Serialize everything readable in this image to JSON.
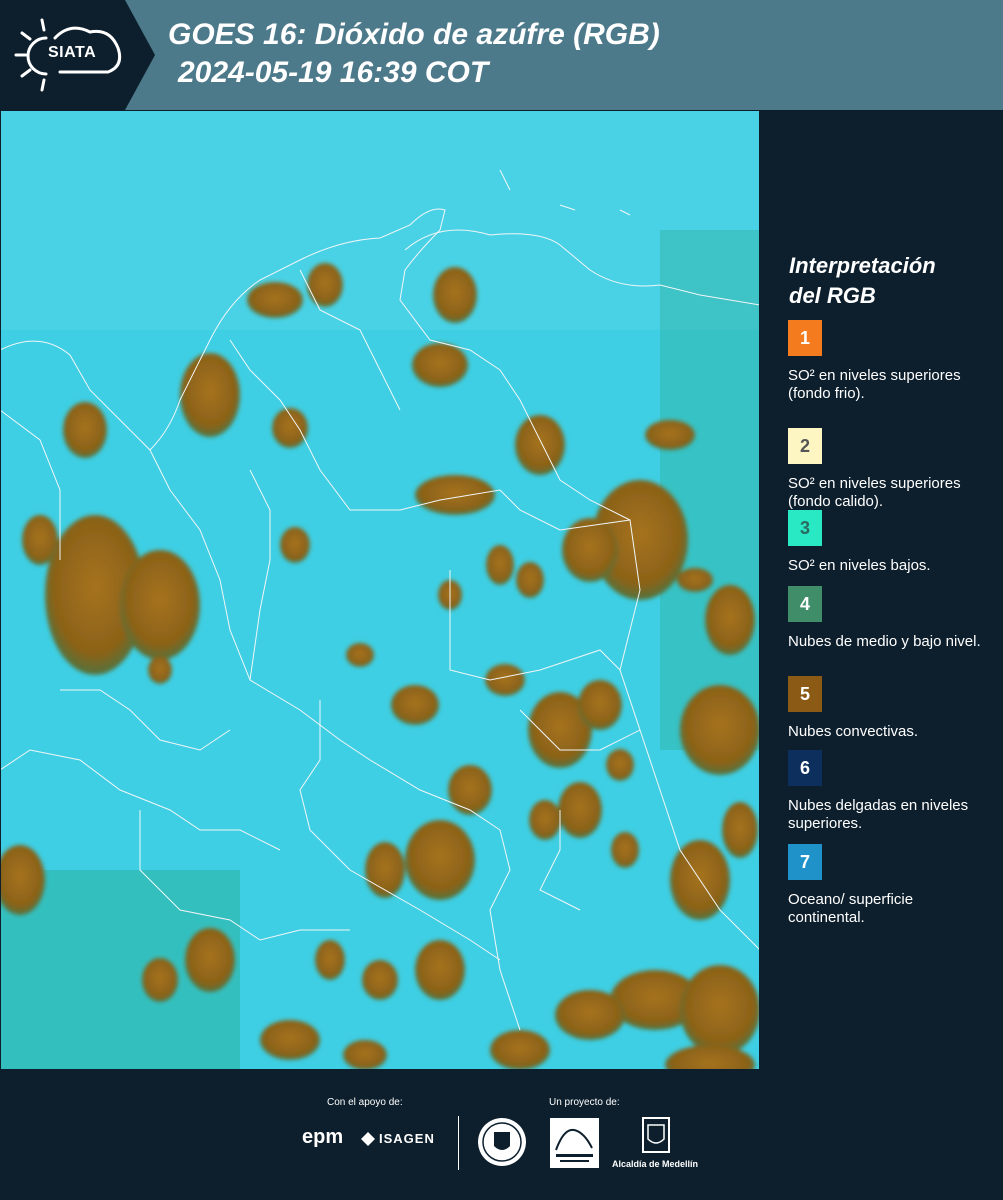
{
  "header": {
    "logo_text": "SIATA",
    "title_line1": "GOES 16: Dióxido de azúfre (RGB)",
    "title_line2": "2024-05-19 16:39 COT"
  },
  "legend": {
    "title_line1": "Interpretación",
    "title_line2": "del RGB",
    "items": [
      {
        "number": "1",
        "color": "#f47c1e",
        "text_color": "#ffffff",
        "label": "SO² en niveles superiores (fondo frio)."
      },
      {
        "number": "2",
        "color": "#fdf5c2",
        "text_color": "#555555",
        "label": "SO² en niveles superiores (fondo calido)."
      },
      {
        "number": "3",
        "color": "#29e8c4",
        "text_color": "#2a6a60",
        "label": "SO² en niveles bajos."
      },
      {
        "number": "4",
        "color": "#3f8e69",
        "text_color": "#ffffff",
        "label": "Nubes de medio y bajo nivel."
      },
      {
        "number": "5",
        "color": "#8b5a14",
        "text_color": "#ffffff",
        "label": "Nubes convectivas."
      },
      {
        "number": "6",
        "color": "#0d2f5e",
        "text_color": "#ffffff",
        "label": "Nubes delgadas en niveles superiores."
      },
      {
        "number": "7",
        "color": "#1f93c9",
        "text_color": "#ffffff",
        "label": "Oceano/ superficie continental."
      }
    ]
  },
  "footer": {
    "support_label": "Con el apoyo de:",
    "project_label": "Un proyecto de:",
    "epm": "epm",
    "isagen": "ISAGEN",
    "alcaldia": "Alcaldía de Medellín"
  },
  "colors": {
    "header_bg": "#4d7a8a",
    "panel_bg": "#0d1f2d",
    "map_surface": "#3ed0e6",
    "cloud": "#9a6a1c"
  }
}
